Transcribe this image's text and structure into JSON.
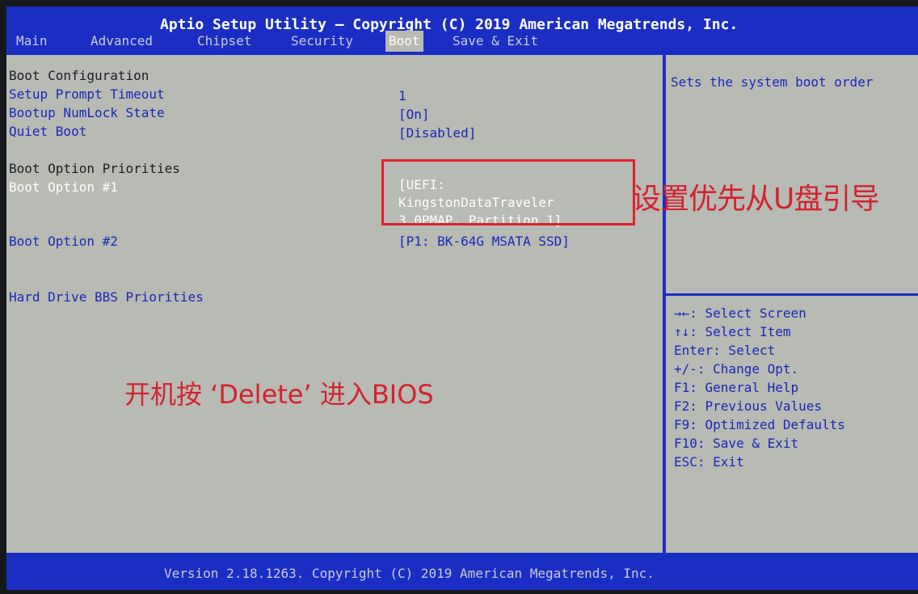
{
  "header": {
    "title": "Aptio Setup Utility – Copyright (C) 2019 American Megatrends, Inc.",
    "tabs": [
      {
        "label": "Main"
      },
      {
        "label": "Advanced"
      },
      {
        "label": "Chipset"
      },
      {
        "label": "Security"
      },
      {
        "label": "Boot",
        "active": true
      },
      {
        "label": "Save & Exit"
      }
    ]
  },
  "main": {
    "boot_configuration": "Boot Configuration",
    "setup_prompt_timeout": {
      "label": "Setup Prompt Timeout",
      "value": "1"
    },
    "bootup_numlock": {
      "label": "Bootup NumLock State",
      "value": "[On]"
    },
    "quiet_boot": {
      "label": "Quiet Boot",
      "value": "[Disabled]"
    },
    "boot_option_priorities": "Boot Option Priorities",
    "boot_option_1": {
      "label": "Boot Option #1",
      "value_lines": [
        "[UEFI:",
        "KingstonDataTraveler",
        "3.0PMAP, Partition 1]"
      ]
    },
    "boot_option_2": {
      "label": "Boot Option #2",
      "value": "[P1: BK-64G MSATA SSD]"
    },
    "hdd_bbs": "Hard Drive BBS Priorities"
  },
  "annotations": {
    "right": "设置优先从U盘引导",
    "middle": "开机按 ‘Delete’ 进入BIOS"
  },
  "help": {
    "description": "Sets the system boot order",
    "keys": [
      "→←: Select Screen",
      "↑↓: Select Item",
      "Enter: Select",
      "+/-: Change Opt.",
      "F1: General Help",
      "F2: Previous Values",
      "F9: Optimized Defaults",
      "F10: Save & Exit",
      "ESC: Exit"
    ]
  },
  "footer": {
    "text": "Version 2.18.1263. Copyright (C) 2019 American Megatrends, Inc."
  },
  "colors": {
    "bar_blue": "#1a2ec4",
    "panel_gray": "#b8bab4",
    "item_blue": "#1828b8",
    "annotation_red": "#d4232d"
  }
}
